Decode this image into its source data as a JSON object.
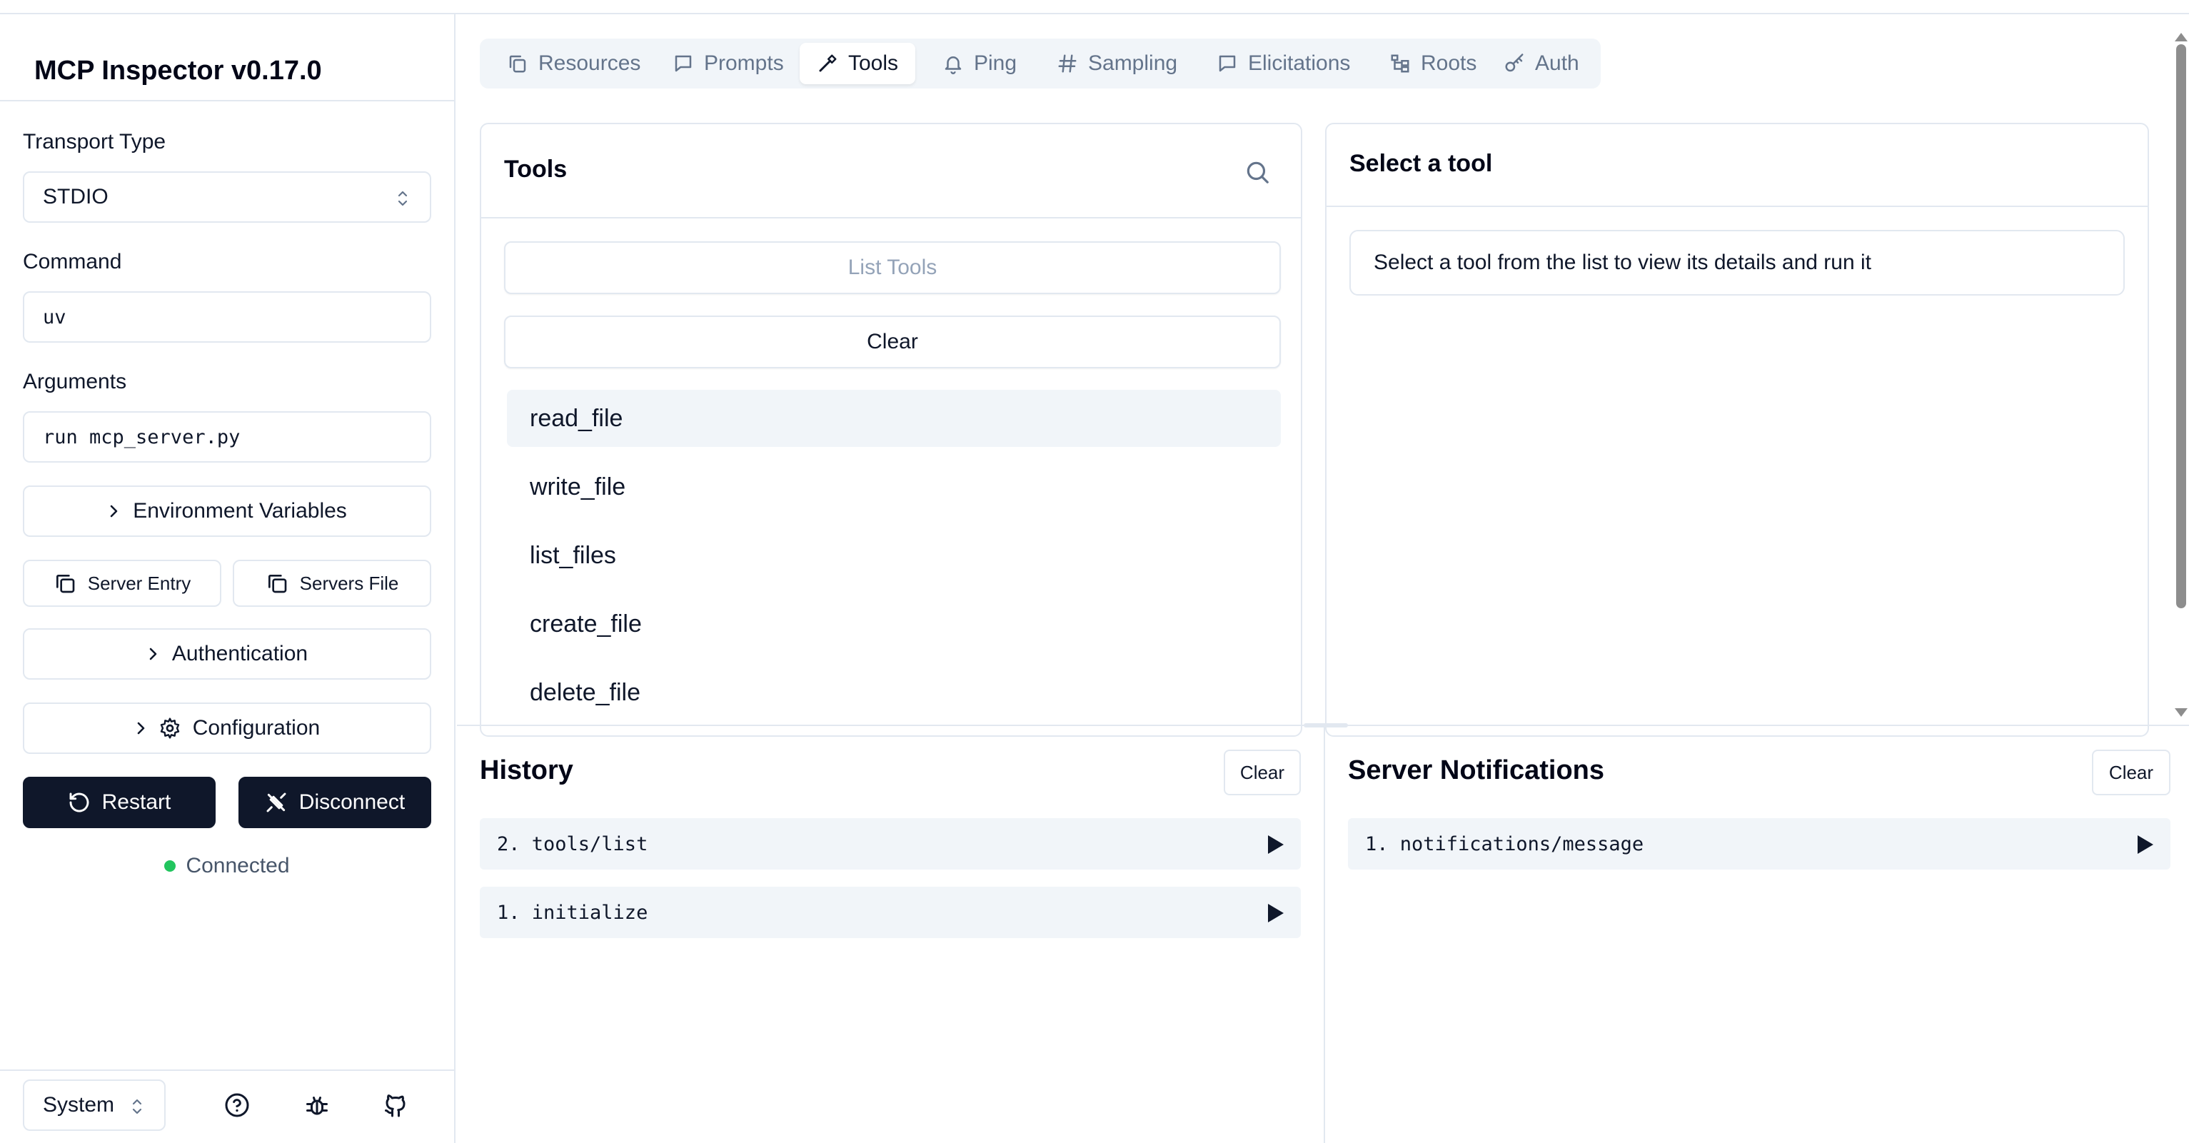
{
  "app": {
    "title": "MCP Inspector v0.17.0"
  },
  "sidebar": {
    "transport_label": "Transport Type",
    "transport_value": "STDIO",
    "command_label": "Command",
    "command_value": "uv",
    "arguments_label": "Arguments",
    "arguments_value": "run mcp_server.py",
    "env_button": "Environment Variables",
    "server_entry_button": "Server Entry",
    "servers_file_button": "Servers File",
    "auth_button": "Authentication",
    "config_button": "Configuration",
    "restart_button": "Restart",
    "disconnect_button": "Disconnect",
    "status": "Connected",
    "theme_value": "System"
  },
  "tabs": [
    {
      "label": "Resources",
      "icon": "file-copy-icon"
    },
    {
      "label": "Prompts",
      "icon": "message-icon"
    },
    {
      "label": "Tools",
      "icon": "hammer-icon",
      "active": true
    },
    {
      "label": "Ping",
      "icon": "bell-icon"
    },
    {
      "label": "Sampling",
      "icon": "hash-icon"
    },
    {
      "label": "Elicitations",
      "icon": "message-icon"
    },
    {
      "label": "Roots",
      "icon": "folder-tree-icon"
    },
    {
      "label": "Auth",
      "icon": "key-icon"
    }
  ],
  "tools_panel": {
    "title": "Tools",
    "list_button": "List Tools",
    "clear_button": "Clear",
    "items": [
      "read_file",
      "write_file",
      "list_files",
      "create_file",
      "delete_file"
    ]
  },
  "detail_panel": {
    "title": "Select a tool",
    "message": "Select a tool from the list to view its details and run it"
  },
  "history": {
    "title": "History",
    "clear_button": "Clear",
    "items": [
      "2. tools/list",
      "1. initialize"
    ]
  },
  "notifications": {
    "title": "Server Notifications",
    "clear_button": "Clear",
    "items": [
      "1. notifications/message"
    ]
  }
}
